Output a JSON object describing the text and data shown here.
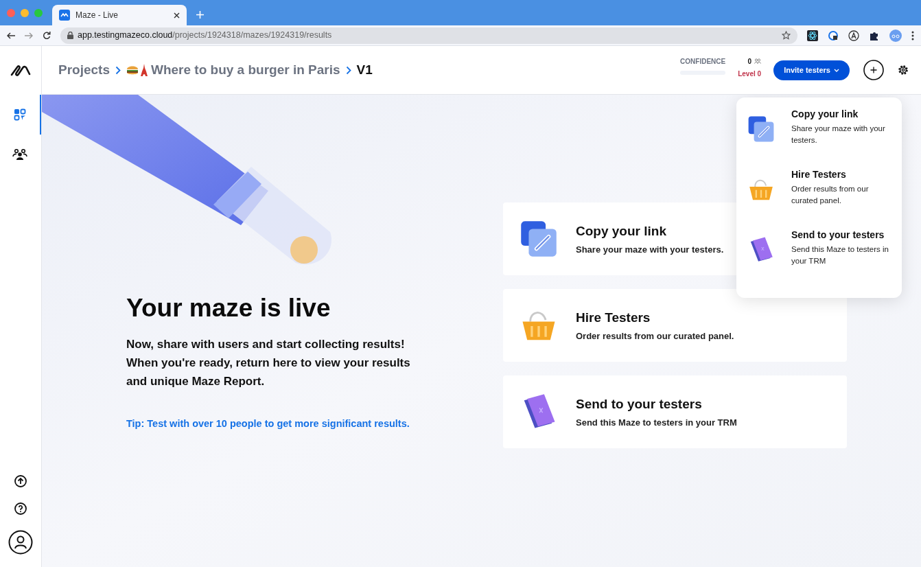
{
  "browser": {
    "tab_title": "Maze - Live",
    "url_host": "app.testingmazeco.cloud",
    "url_path": "/projects/1924318/mazes/1924319/results"
  },
  "breadcrumb": [
    {
      "label": "Projects",
      "kind": "link"
    },
    {
      "label": "Where to buy a burger in Paris",
      "kind": "project"
    },
    {
      "label": "V1",
      "kind": "current"
    }
  ],
  "confidence": {
    "label": "CONFIDENCE",
    "count": "0",
    "level_text": "Level 0"
  },
  "invite_button": "Invite testers",
  "sidebar": {
    "items": [
      {
        "kind": "dashboard",
        "selected": true
      },
      {
        "kind": "team",
        "selected": false
      }
    ]
  },
  "hero": {
    "title": "Your maze is live",
    "text": "Now, share with users and start collecting results! When you're ready, return here to view your results and unique Maze Report.",
    "tip": "Tip: Test with over 10 people to get more significant results."
  },
  "options": [
    {
      "kind": "link",
      "title": "Copy your link",
      "text": "Share your maze with your testers."
    },
    {
      "kind": "hire",
      "title": "Hire Testers",
      "text": "Order results from our curated panel."
    },
    {
      "kind": "send",
      "title": "Send to your testers",
      "text": "Send this Maze to testers in your TRM"
    }
  ],
  "menu": [
    {
      "kind": "link",
      "title": "Copy your link",
      "text": "Share your maze with your testers."
    },
    {
      "kind": "hire",
      "title": "Hire Testers",
      "text": "Order results from our curated panel."
    },
    {
      "kind": "send",
      "title": "Send to your testers",
      "text": "Send this Maze to testers in your TRM"
    }
  ]
}
